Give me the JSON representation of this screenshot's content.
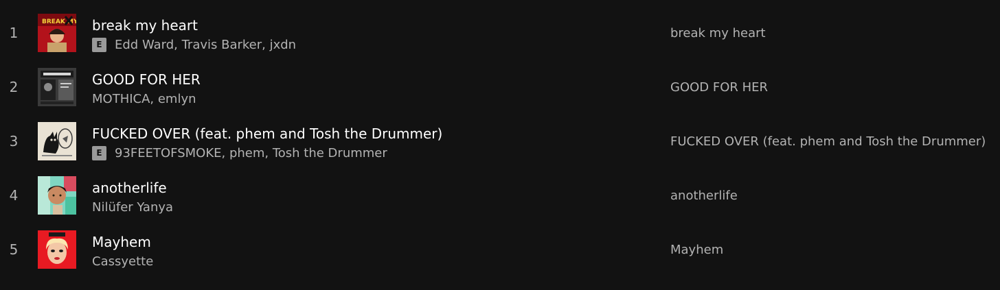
{
  "tracks": [
    {
      "number": "1",
      "title": "break my heart",
      "explicit": true,
      "explicit_label": "E",
      "artists": "Edd Ward, Travis Barker, jxdn",
      "album": "break my heart"
    },
    {
      "number": "2",
      "title": "GOOD FOR HER",
      "explicit": false,
      "explicit_label": "",
      "artists": "MOTHICA, emlyn",
      "album": "GOOD FOR HER"
    },
    {
      "number": "3",
      "title": "FUCKED OVER (feat. phem and Tosh the Drummer)",
      "explicit": true,
      "explicit_label": "E",
      "artists": "93FEETOFSMOKE, phem, Tosh the Drummer",
      "album": "FUCKED OVER (feat. phem and Tosh the Drummer)"
    },
    {
      "number": "4",
      "title": "anotherlife",
      "explicit": false,
      "explicit_label": "",
      "artists": "Nilüfer Yanya",
      "album": "anotherlife"
    },
    {
      "number": "5",
      "title": "Mayhem",
      "explicit": false,
      "explicit_label": "",
      "artists": "Cassyette",
      "album": "Mayhem"
    }
  ],
  "colors": {
    "background": "#121212",
    "primary_text": "#ffffff",
    "secondary_text": "#b3b3b3",
    "explicit_badge": "#9a9a9a"
  }
}
